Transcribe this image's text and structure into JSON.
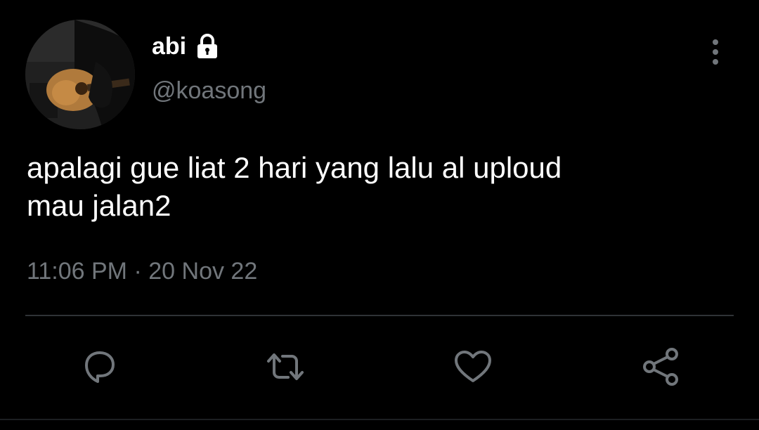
{
  "user": {
    "display_name": "abi",
    "handle": "@koasong",
    "protected": true,
    "avatar_icon": "guitarist-photo"
  },
  "tweet": {
    "text": "apalagi gue liat 2 hari yang lalu al uploud\nmau jalan2",
    "time": "11:06 PM",
    "separator": "·",
    "date": "20 Nov 22"
  },
  "actions": {
    "reply_icon": "reply-icon",
    "retweet_icon": "retweet-icon",
    "like_icon": "heart-icon",
    "share_icon": "share-icon"
  },
  "colors": {
    "background": "#000000",
    "primary_text": "#ffffff",
    "secondary_text": "#71767b",
    "divider": "#2f3336"
  }
}
